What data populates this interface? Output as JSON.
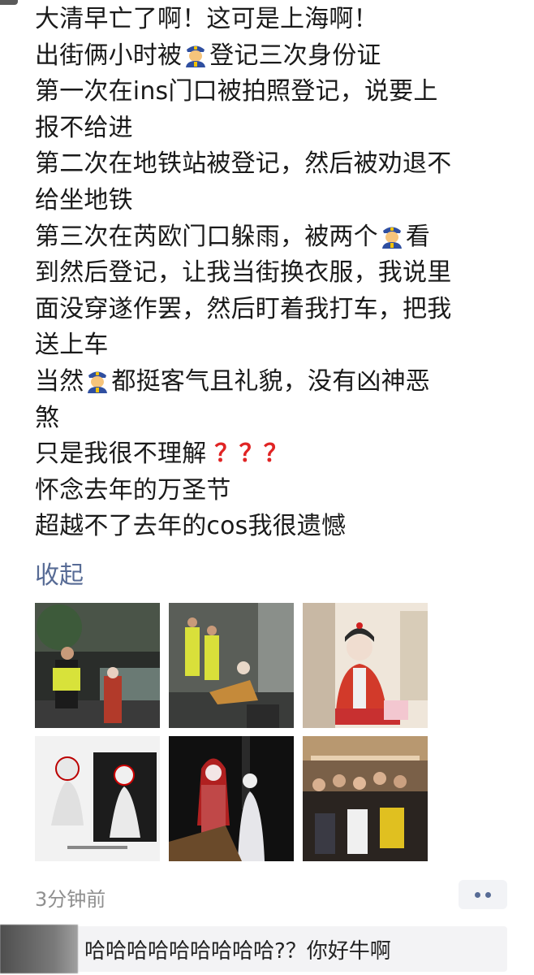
{
  "post": {
    "lines": [
      "大清早亡了啊！这可是上海啊！",
      "出街俩小时被",
      "登记三次身份证",
      "第一次在ins门口被拍照登记，说要上",
      "报不给进",
      "第二次在地铁站被登记，然后被劝退不",
      "给坐地铁",
      "第三次在芮欧门口躲雨，被两个",
      "看",
      "到然后登记，让我当街换衣服，我说里",
      "面没穿遂作罢，然后盯着我打车，把我",
      "送上车",
      "当然",
      "都挺客气且礼貌，没有凶神恶",
      "煞",
      "只是我很不理解",
      "？？？",
      "怀念去年的万圣节",
      "超越不了去年的cos我很遗憾"
    ],
    "emoji_icon": "police-officer-icon"
  },
  "collapse_label": "收起",
  "photos": [
    {
      "name": "photo-1",
      "desc_icon": "photo"
    },
    {
      "name": "photo-2",
      "desc_icon": "photo"
    },
    {
      "name": "photo-3",
      "desc_icon": "photo"
    },
    {
      "name": "photo-4",
      "desc_icon": "photo"
    },
    {
      "name": "photo-5",
      "desc_icon": "photo"
    },
    {
      "name": "photo-6",
      "desc_icon": "photo"
    }
  ],
  "meta": {
    "timestamp": "3分钟前",
    "more_icon": "more-dots-icon"
  },
  "comment": {
    "text": "哈哈哈哈哈哈哈哈哈?？你好牛啊"
  },
  "colors": {
    "link": "#576b95",
    "question_mark": "#e02424",
    "timestamp": "#8f8f8f"
  }
}
